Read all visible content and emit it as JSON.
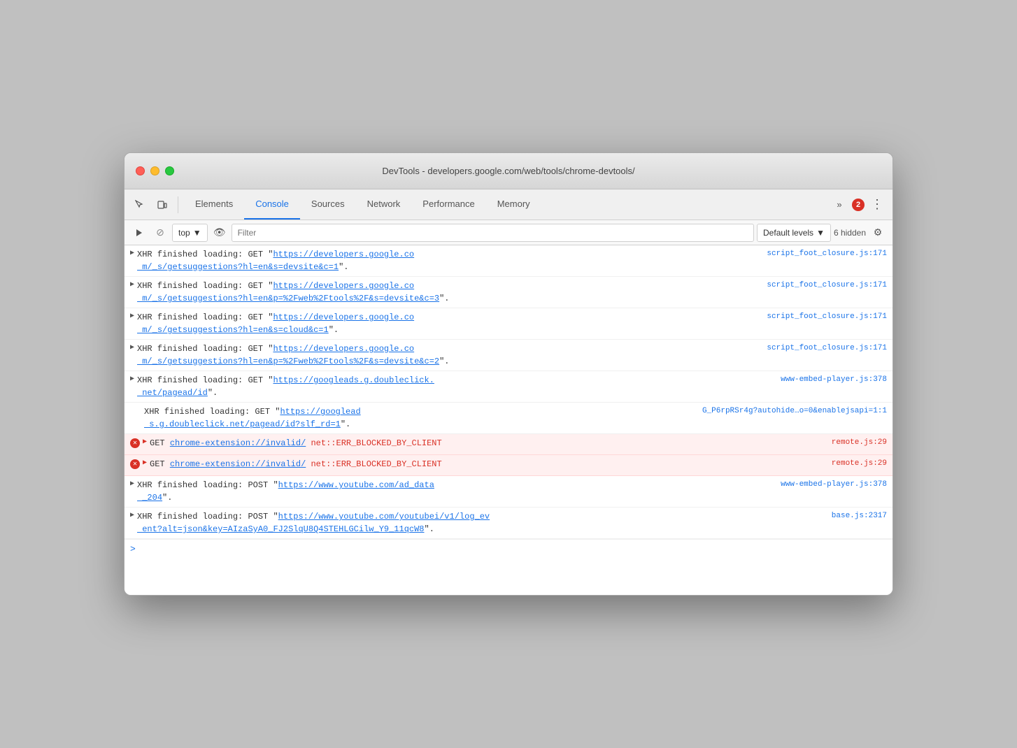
{
  "window": {
    "title": "DevTools - developers.google.com/web/tools/chrome-devtools/"
  },
  "toolbar": {
    "tabs": [
      {
        "id": "elements",
        "label": "Elements",
        "active": false
      },
      {
        "id": "console",
        "label": "Console",
        "active": true
      },
      {
        "id": "sources",
        "label": "Sources",
        "active": false
      },
      {
        "id": "network",
        "label": "Network",
        "active": false
      },
      {
        "id": "performance",
        "label": "Performance",
        "active": false
      },
      {
        "id": "memory",
        "label": "Memory",
        "active": false
      }
    ],
    "error_count": "2",
    "more_label": "»"
  },
  "console_toolbar": {
    "context": "top",
    "filter_placeholder": "Filter",
    "levels": "Default levels",
    "hidden_count": "6 hidden"
  },
  "log_entries": [
    {
      "id": 1,
      "type": "xhr",
      "icon": "▶",
      "text": "XHR finished loading: GET \"https://developers.google.co m/_s/getsuggestions?hl=en&s=devsite&c=1\".",
      "url": "https://developers.google.co m/_s/getsuggestions?hl=en&s=devsite&c=1",
      "source": "script_foot_closure.js:171",
      "error": false
    },
    {
      "id": 2,
      "type": "xhr",
      "icon": "▶",
      "text": "XHR finished loading: GET \"https://developers.google.co m/_s/getsuggestions?hl=en&p=%2Fweb%2Ftools%2F&s=devsite&c=3\".",
      "url": "https://developers.google.co m/_s/getsuggestions?hl=en&p=%2Fweb%2Ftools%2F&s=devsite&c=3",
      "source": "script_foot_closure.js:171",
      "error": false
    },
    {
      "id": 3,
      "type": "xhr",
      "icon": "▶",
      "text": "XHR finished loading: GET \"https://developers.google.co m/_s/getsuggestions?hl=en&s=cloud&c=1\".",
      "url": "https://developers.google.co m/_s/getsuggestions?hl=en&s=cloud&c=1",
      "source": "script_foot_closure.js:171",
      "error": false
    },
    {
      "id": 4,
      "type": "xhr",
      "icon": "▶",
      "text": "XHR finished loading: GET \"https://developers.google.co m/_s/getsuggestions?hl=en&p=%2Fweb%2Ftools%2F&s=devsite&c=2\".",
      "url": "https://developers.google.co m/_s/getsuggestions?hl=en&p=%2Fweb%2Ftools%2F&s=devsite&c=2",
      "source": "script_foot_closure.js:171",
      "error": false
    },
    {
      "id": 5,
      "type": "xhr",
      "icon": "▶",
      "text": "XHR finished loading: GET \"https://googleads.g.doubleclick. net/pagead/id\".",
      "url": "https://googleads.g.doubleclick. net/pagead/id",
      "source": "www-embed-player.js:378",
      "error": false
    },
    {
      "id": 6,
      "type": "xhr_no_triangle",
      "icon": "",
      "text": "XHR finished loading: GET \"https://googlead s.g.doubleclick.net/pagead/id?slf_rd=1\".",
      "url_display": "https://googlead s.g.doubleclick.net/pagead/id?slf_rd=1",
      "source": "G_P6rpRSr4g?autohide…o=0&enablejsapi=1:1",
      "error": false
    },
    {
      "id": 7,
      "type": "error",
      "icon": "×",
      "text_get": "GET",
      "text_url": "chrome-extension://invalid/",
      "text_error": " net::ERR_BLOCKED_BY_CLIENT",
      "source": "remote.js:29",
      "error": true
    },
    {
      "id": 8,
      "type": "error",
      "icon": "×",
      "text_get": "GET",
      "text_url": "chrome-extension://invalid/",
      "text_error": " net::ERR_BLOCKED_BY_CLIENT",
      "source": "remote.js:29",
      "error": true
    },
    {
      "id": 9,
      "type": "xhr",
      "icon": "▶",
      "text": "XHR finished loading: POST \"https://www.youtube.com/ad_data _204\".",
      "url": "https://www.youtube.com/ad_data _204",
      "source": "www-embed-player.js:378",
      "error": false
    },
    {
      "id": 10,
      "type": "xhr",
      "icon": "▶",
      "text": "XHR finished loading: POST \"https://www.youtube.com/youtubei/v1/log_ev ent?alt=json&key=AIzaSyA0_FJ2SlqU8Q4STEHLGCilw_Y9_11qcW8\".",
      "url": "https://www.youtube.com/youtubei/v1/log_ev ent?alt=json&key=AIzaSyA0_FJ2SlqU8Q4STEHLGCilw_Y9_11qcW8",
      "source": "base.js:2317",
      "error": false
    }
  ],
  "console_prompt": ">"
}
